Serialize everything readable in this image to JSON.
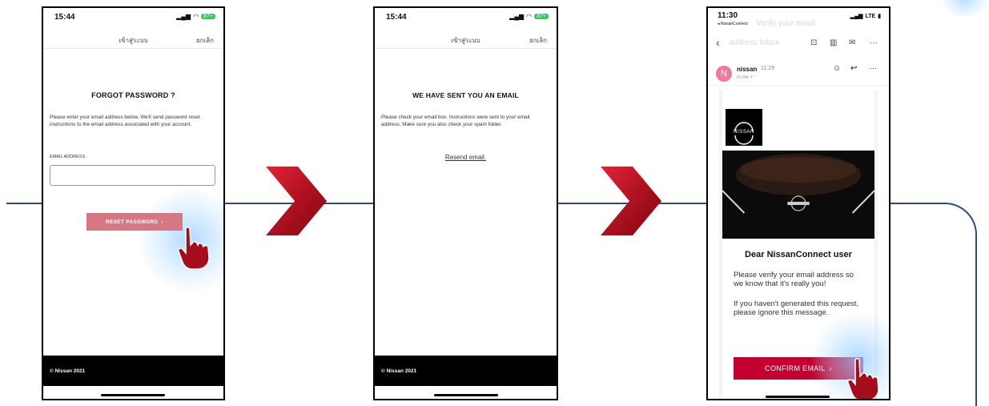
{
  "screen1": {
    "time": "15:44",
    "battery": "87+",
    "nav_title": "เข้าสู่ระบบ",
    "nav_cancel": "ยกเลิก",
    "heading": "FORGOT PASSWORD ?",
    "instructions": "Please enter your email address below. We'll send password reset instructions to the email address associated with your account.",
    "email_label": "EMAIL ADDRESS",
    "email_value": "",
    "reset_button": "RESET PASSWORD",
    "reset_chevron": "›",
    "footer": "© Nissan 2021"
  },
  "screen2": {
    "time": "15:44",
    "battery": "87+",
    "nav_title": "เข้าสู่ระบบ",
    "nav_cancel": "ยกเลิก",
    "heading": "WE HAVE SENT YOU AN EMAIL",
    "instructions": "Please check your email box. Instructions were sent to your email address. Make sure you also check your spam folder.",
    "resend_link": "Resend email.",
    "footer": "© Nissan 2021"
  },
  "screen3": {
    "time": "11:30",
    "back_label": "◂ NissanConnect",
    "network": "LTE",
    "ghost_title": "Verify your email",
    "ghost_subtitle": "address Inbox",
    "sender": "nissan",
    "send_time": "11:29",
    "to_me": "to me ˅",
    "avatar_letter": "N",
    "brand_logo": "NISSAN",
    "greeting": "Dear NissanConnect user",
    "paragraph1": "Please verify your email address so we know that it's really you!",
    "paragraph2": "If you haven't generated this request, please ignore this message.",
    "confirm_button": "CONFIRM EMAIL",
    "confirm_chevron": "›"
  },
  "colors": {
    "flow_line": "#2e4a7a",
    "chevron_red": "#b0111f",
    "reset_button": "#d67884",
    "confirm_button": "#c3002f",
    "avatar": "#f3799a"
  }
}
